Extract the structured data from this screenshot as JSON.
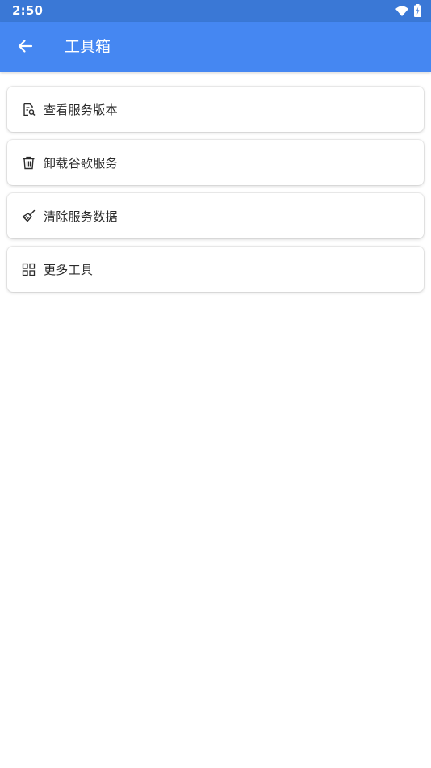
{
  "status_bar": {
    "time": "2:50",
    "icons": [
      "wifi-icon",
      "battery-charging-icon"
    ]
  },
  "app_bar": {
    "back_icon": "arrow-left-icon",
    "title": "工具箱"
  },
  "colors": {
    "status_bar": "#3a78d6",
    "app_bar": "#4587f2",
    "card_text": "#2b2b2b",
    "background": "#ffffff"
  },
  "menu": {
    "items": [
      {
        "label": "查看服务版本",
        "icon": "document-search-icon"
      },
      {
        "label": "卸载谷歌服务",
        "icon": "trash-icon"
      },
      {
        "label": "清除服务数据",
        "icon": "broom-icon"
      },
      {
        "label": "更多工具",
        "icon": "grid-icon"
      }
    ]
  }
}
